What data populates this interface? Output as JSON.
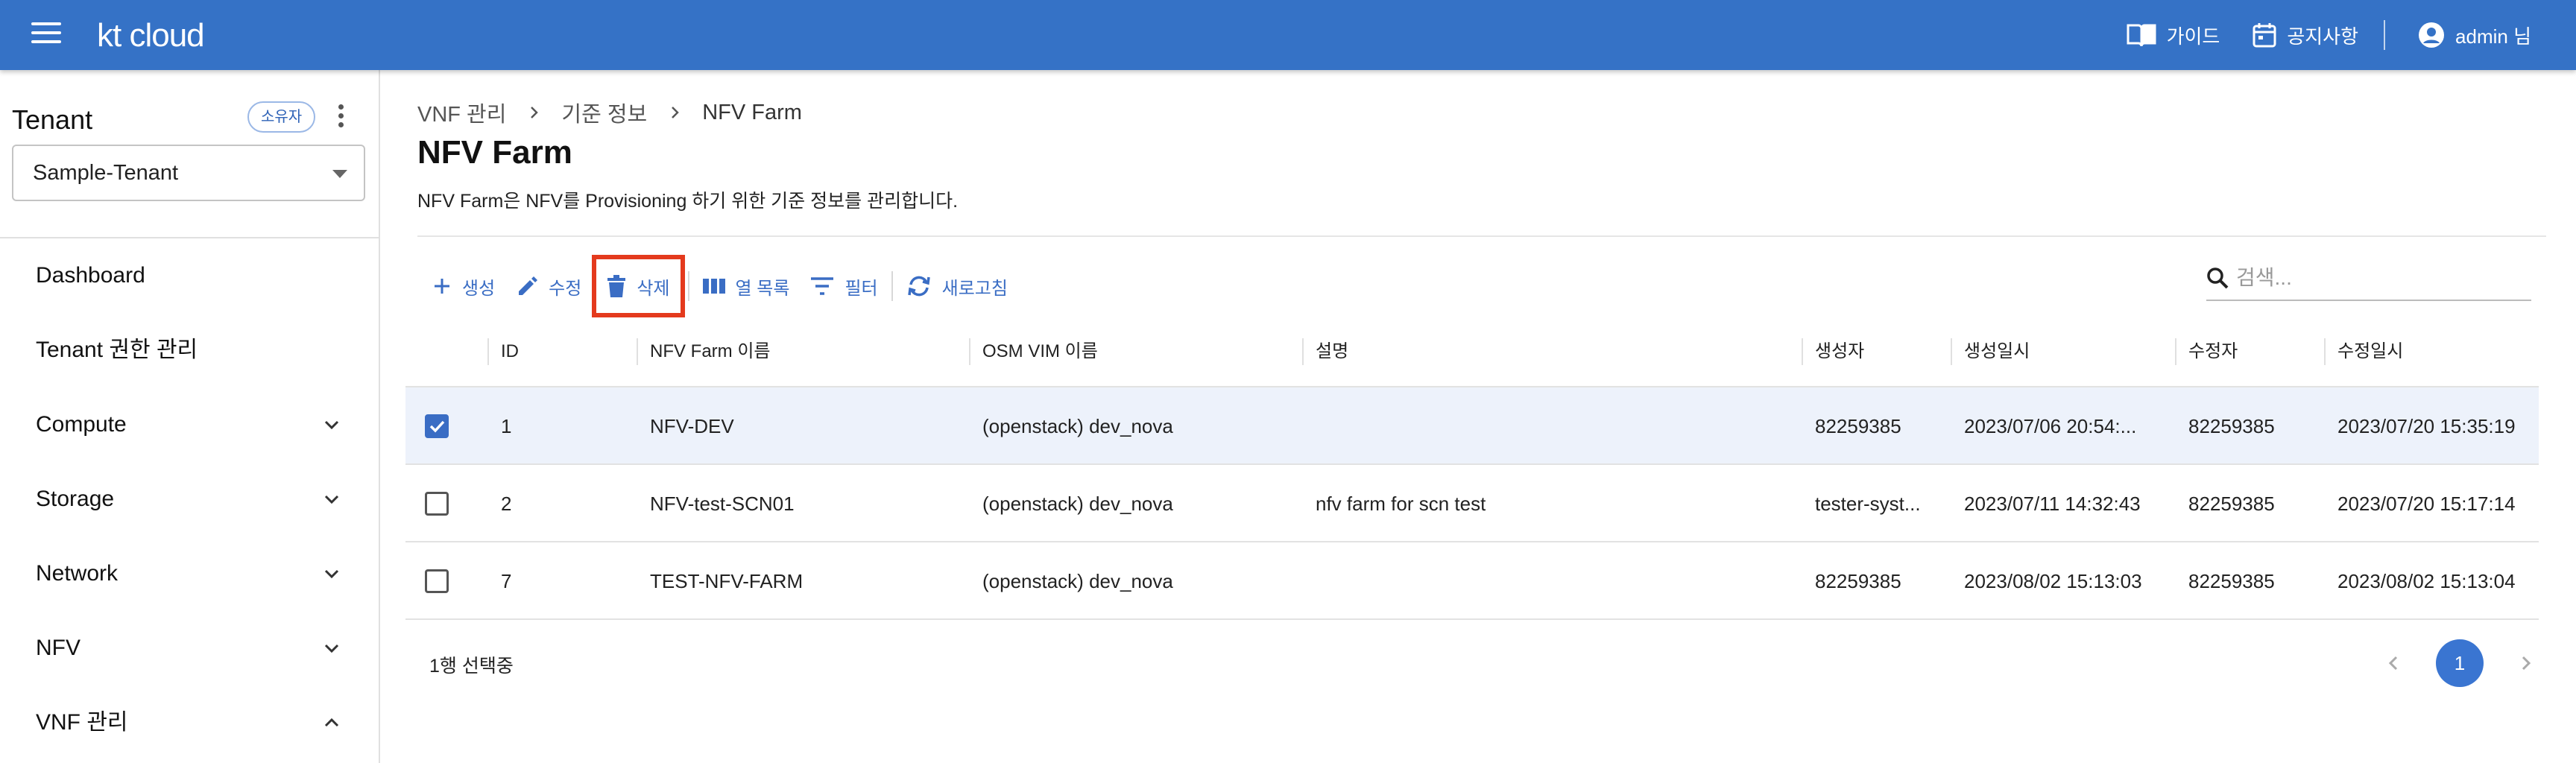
{
  "header": {
    "logo": "kt cloud",
    "guide_label": "가이드",
    "notice_label": "공지사항",
    "user_label": "admin 님"
  },
  "sidebar": {
    "tenant_title": "Tenant",
    "owner_badge": "소유자",
    "tenant_value": "Sample-Tenant",
    "items": [
      {
        "label": "Dashboard",
        "chevron": "none"
      },
      {
        "label": "Tenant 권한 관리",
        "chevron": "none"
      },
      {
        "label": "Compute",
        "chevron": "down"
      },
      {
        "label": "Storage",
        "chevron": "down"
      },
      {
        "label": "Network",
        "chevron": "down"
      },
      {
        "label": "NFV",
        "chevron": "down"
      },
      {
        "label": "VNF 관리",
        "chevron": "up"
      }
    ]
  },
  "main": {
    "breadcrumb": [
      "VNF 관리",
      "기준 정보",
      "NFV Farm"
    ],
    "title": "NFV Farm",
    "description": "NFV Farm은 NFV를 Provisioning 하기 위한 기준 정보를 관리합니다.",
    "toolbar": {
      "create": "생성",
      "edit": "수정",
      "delete": "삭제",
      "columns": "열 목록",
      "filter": "필터",
      "refresh": "새로고침"
    },
    "search": {
      "placeholder": "검색..."
    },
    "table": {
      "columns": [
        "ID",
        "NFV Farm 이름",
        "OSM VIM 이름",
        "설명",
        "생성자",
        "생성일시",
        "수정자",
        "수정일시"
      ],
      "rows": [
        {
          "selected": true,
          "id": "1",
          "name": "NFV-DEV",
          "vim": "(openstack) dev_nova",
          "desc": "",
          "creator": "82259385",
          "created": "2023/07/06 20:54:...",
          "modifier": "82259385",
          "modified": "2023/07/20 15:35:19"
        },
        {
          "selected": false,
          "id": "2",
          "name": "NFV-test-SCN01",
          "vim": "(openstack) dev_nova",
          "desc": "nfv farm for scn test",
          "creator": "tester-syst...",
          "created": "2023/07/11 14:32:43",
          "modifier": "82259385",
          "modified": "2023/07/20 15:17:14"
        },
        {
          "selected": false,
          "id": "7",
          "name": "TEST-NFV-FARM",
          "vim": "(openstack) dev_nova",
          "desc": "",
          "creator": "82259385",
          "created": "2023/08/02 15:13:03",
          "modifier": "82259385",
          "modified": "2023/08/02 15:13:04"
        }
      ]
    },
    "footer": {
      "selection": "1행 선택중",
      "page": "1"
    }
  },
  "colors": {
    "header_bg": "#3572c6",
    "accent": "#3a6dc4",
    "highlight_border": "#e43a1d",
    "selected_row": "#edf2fb"
  },
  "icons": [
    "menu-icon",
    "book-icon",
    "calendar-icon",
    "account-circle-icon",
    "plus-icon",
    "pencil-icon",
    "trash-icon",
    "columns-icon",
    "filter-icon",
    "refresh-icon",
    "search-icon",
    "chevron-down-icon",
    "chevron-up-icon",
    "chevron-left-icon",
    "chevron-right-icon"
  ]
}
